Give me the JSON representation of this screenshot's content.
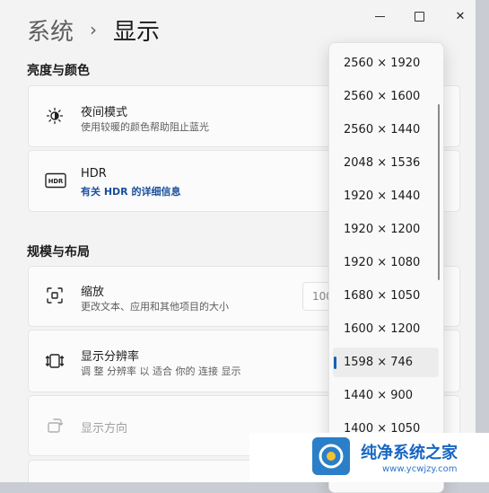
{
  "breadcrumb": {
    "parent": "系统",
    "separator": "›",
    "current": "显示"
  },
  "window_controls": {
    "minimize": "minimize",
    "maximize": "maximize",
    "close": "✕"
  },
  "sections": {
    "brightness": {
      "title": "亮度与颜色"
    },
    "scale_layout": {
      "title": "规模与布局"
    }
  },
  "cards": {
    "night_light": {
      "icon": "night-light-icon",
      "title": "夜间模式",
      "subtitle": "使用较暖的颜色帮助阻止蓝光"
    },
    "hdr": {
      "icon": "hdr-icon",
      "icon_label": "HDR",
      "title": "HDR",
      "link": "有关 HDR 的详细信息"
    },
    "scale": {
      "icon": "scale-icon",
      "title": "缩放",
      "subtitle": "更改文本、应用和其他项目的大小",
      "value_partial": "100"
    },
    "resolution": {
      "icon": "resolution-icon",
      "title": "显示分辨率",
      "subtitle": "调 整 分辨率 以 适合 你的 连接 显示"
    },
    "orientation": {
      "icon": "orientation-icon",
      "title": "显示方向",
      "disabled": true
    }
  },
  "dropdown": {
    "options": [
      "2560 × 1920",
      "2560 × 1600",
      "2560 × 1440",
      "2048 × 1536",
      "1920 × 1440",
      "1920 × 1200",
      "1920 × 1080",
      "1680 × 1050",
      "1600 × 1200",
      "1598 × 746",
      "1440 × 900",
      "1400 × 1050"
    ],
    "selected": "1598 × 746",
    "accent": "#1a5fb4"
  },
  "watermark": {
    "title": "纯净系统之家",
    "url": "www.ycwjzy.com"
  },
  "colors": {
    "link": "#1a4f9c",
    "accent": "#1a5fb4",
    "window_bg": "#f3f3f3"
  }
}
